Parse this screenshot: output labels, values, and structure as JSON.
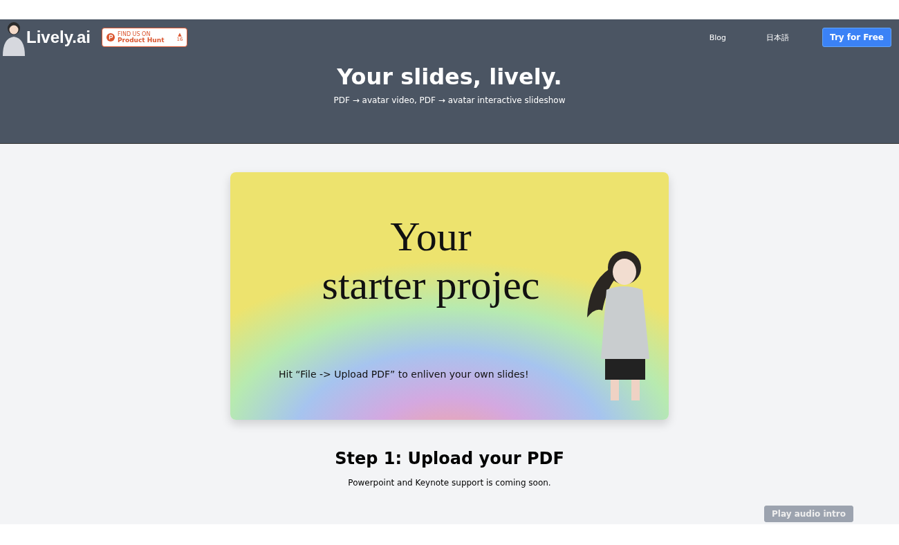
{
  "header": {
    "logo": "Lively.ai",
    "badge": {
      "eyebrow": "FIND US ON",
      "name": "Product Hunt",
      "arrow": "▲",
      "count": "16"
    },
    "nav": [
      {
        "label": "Blog",
        "kind": "link"
      },
      {
        "label": "日本語",
        "kind": "link"
      },
      {
        "label": "Try for Free",
        "kind": "button"
      }
    ],
    "title": "Your slides, lively.",
    "subtitle": "PDF → avatar video, PDF → avatar interactive slideshow"
  },
  "slide": {
    "title_lines": [
      "Your",
      "starter projec"
    ],
    "hint": "Hit “File -> Upload PDF” to enliven your own slides!"
  },
  "step": {
    "title": "Step 1: Upload your PDF",
    "note": "Powerpoint and Keynote support is coming soon."
  },
  "audio_button": {
    "label": "Play audio intro",
    "disabled": true
  }
}
